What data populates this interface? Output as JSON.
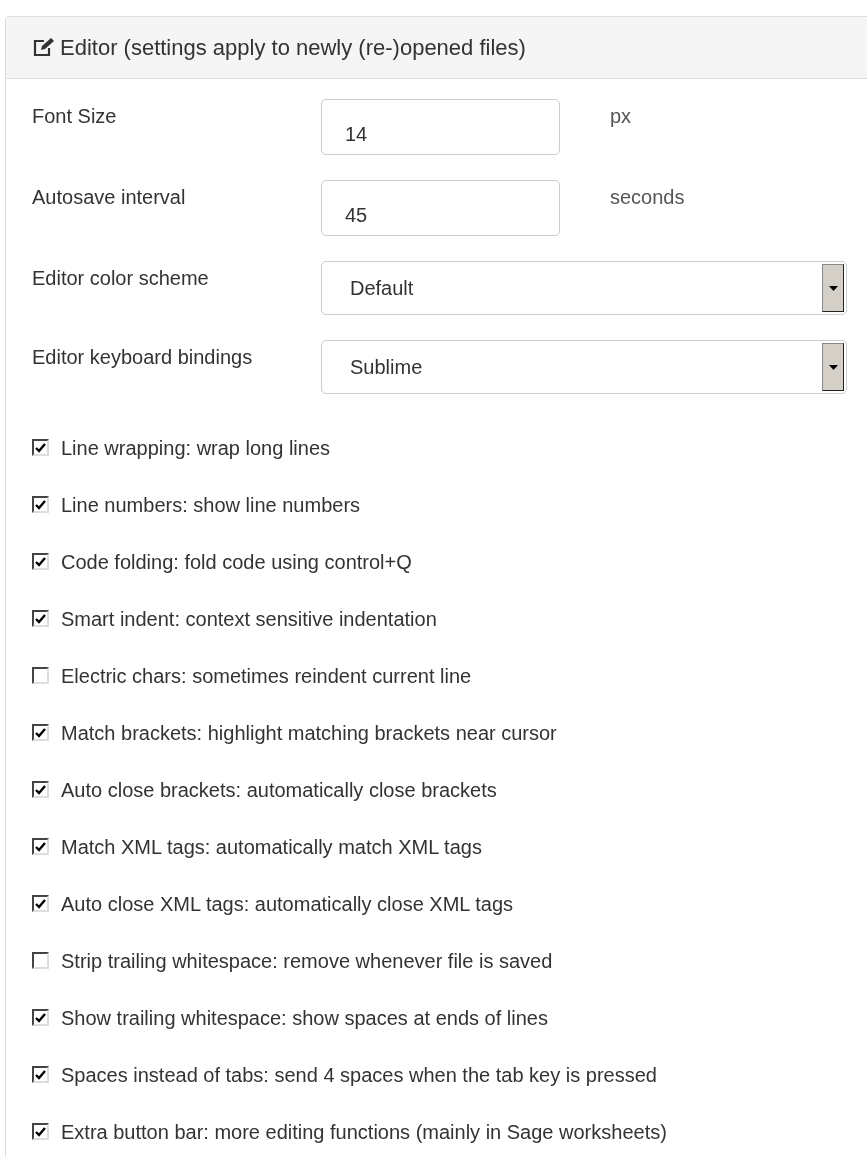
{
  "panel": {
    "title": "Editor (settings apply to newly (re-)opened files)"
  },
  "fields": [
    {
      "kind": "number",
      "label": "Font Size",
      "value": "14",
      "unit": "px"
    },
    {
      "kind": "number",
      "label": "Autosave interval",
      "value": "45",
      "unit": "seconds"
    },
    {
      "kind": "select",
      "label": "Editor color scheme",
      "value": "Default"
    },
    {
      "kind": "select",
      "label": "Editor keyboard bindings",
      "value": "Sublime"
    }
  ],
  "options": [
    {
      "label": "Line wrapping: wrap long lines",
      "checked": true
    },
    {
      "label": "Line numbers: show line numbers",
      "checked": true
    },
    {
      "label": "Code folding: fold code using control+Q",
      "checked": true
    },
    {
      "label": "Smart indent: context sensitive indentation",
      "checked": true
    },
    {
      "label": "Electric chars: sometimes reindent current line",
      "checked": false
    },
    {
      "label": "Match brackets: highlight matching brackets near cursor",
      "checked": true
    },
    {
      "label": "Auto close brackets: automatically close brackets",
      "checked": true
    },
    {
      "label": "Match XML tags: automatically match XML tags",
      "checked": true
    },
    {
      "label": "Auto close XML tags: automatically close XML tags",
      "checked": true
    },
    {
      "label": "Strip trailing whitespace: remove whenever file is saved",
      "checked": false
    },
    {
      "label": "Show trailing whitespace: show spaces at ends of lines",
      "checked": true
    },
    {
      "label": "Spaces instead of tabs: send 4 spaces when the tab key is pressed",
      "checked": true
    },
    {
      "label": "Extra button bar: more editing functions (mainly in Sage worksheets)",
      "checked": true
    }
  ]
}
